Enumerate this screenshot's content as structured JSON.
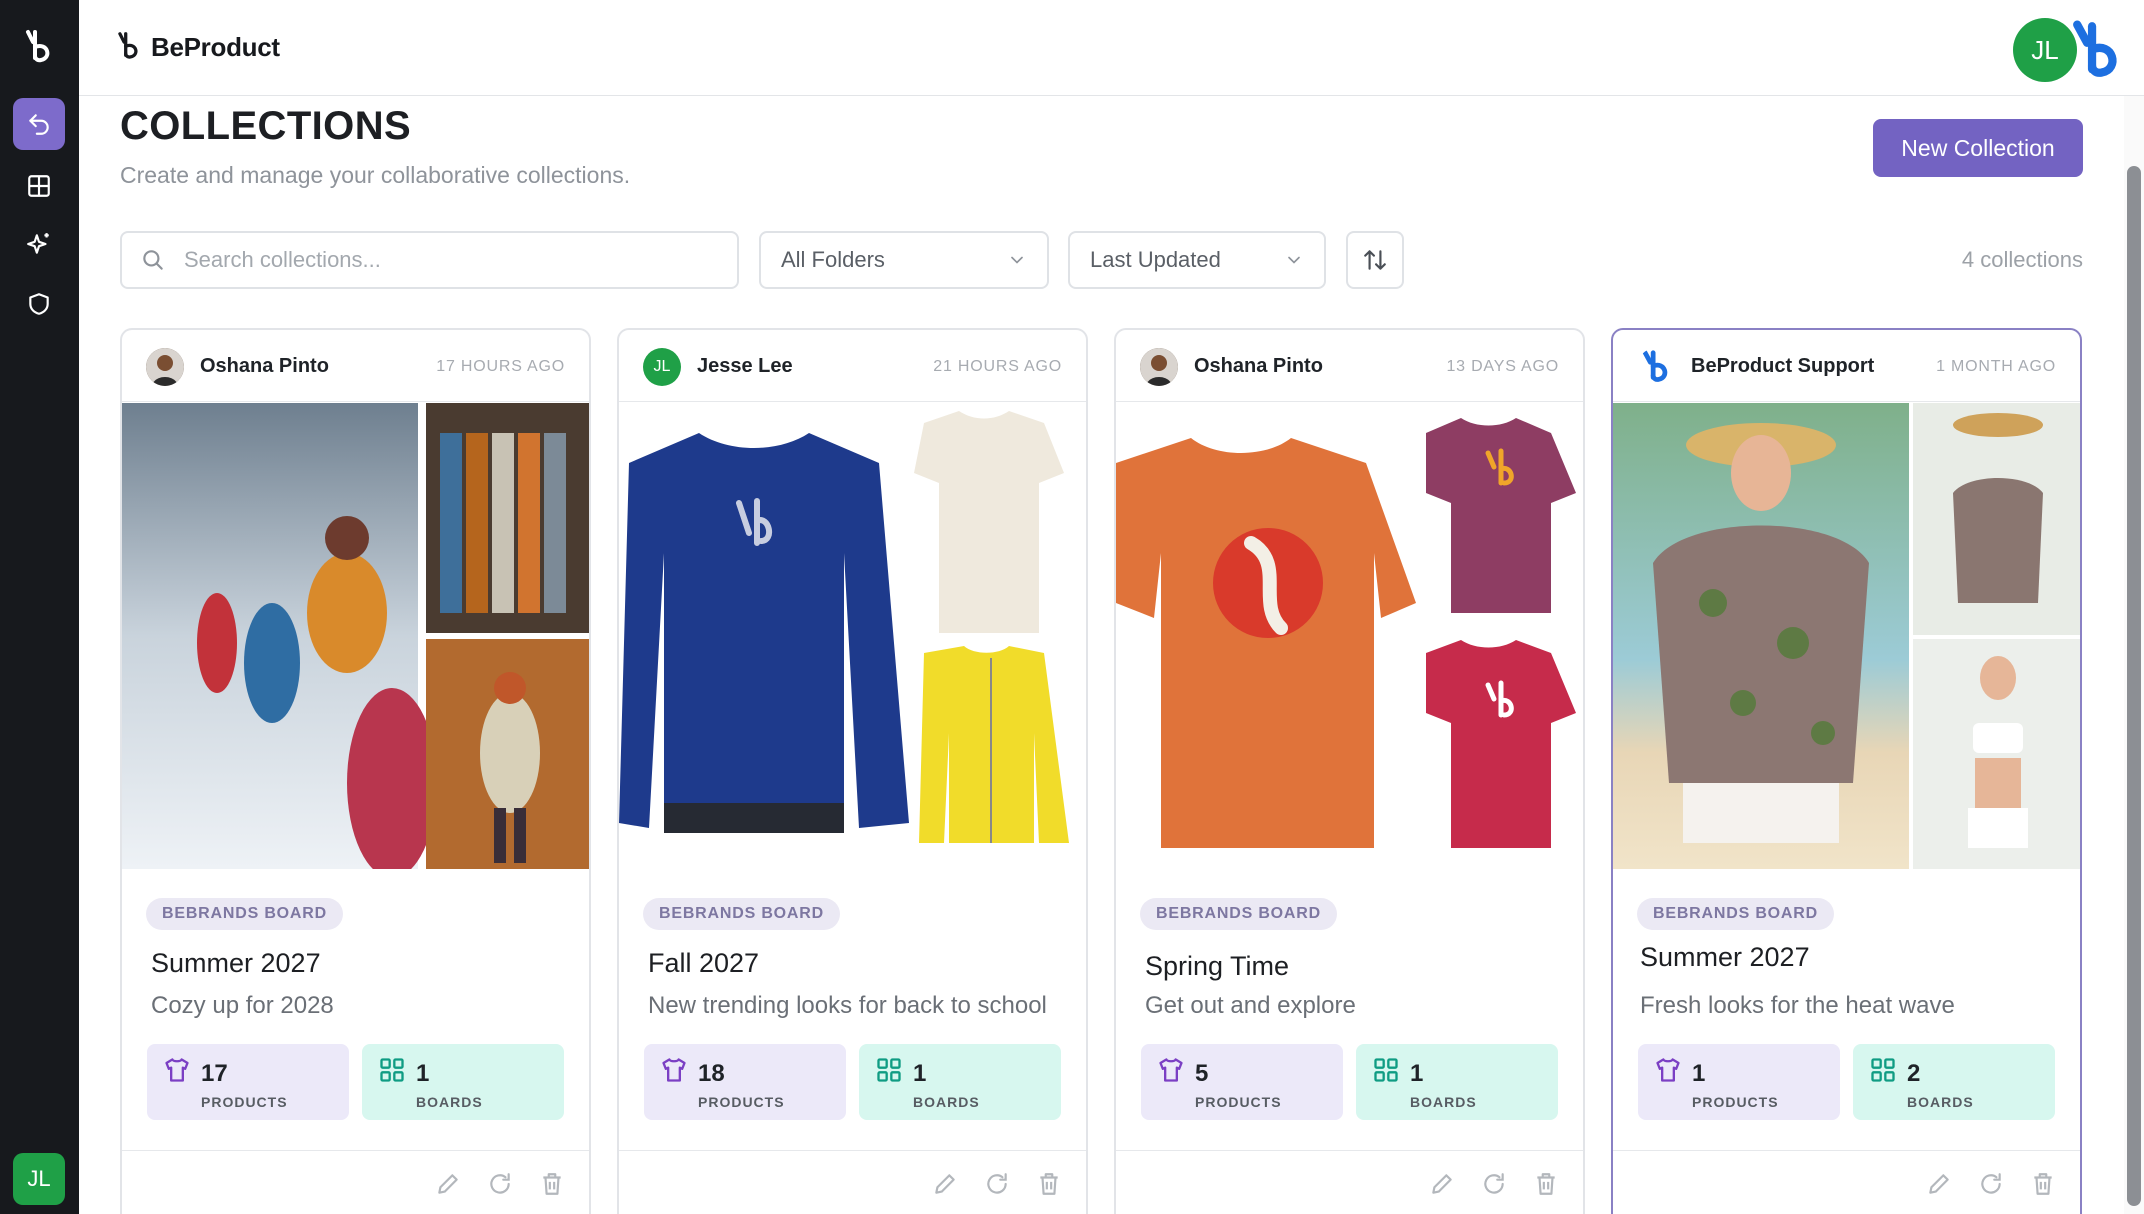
{
  "app": {
    "brand": "BeProduct",
    "user_initials": "JL"
  },
  "header": {
    "title": "COLLECTIONS",
    "subtitle": "Create and manage your collaborative collections.",
    "new_button": "New Collection"
  },
  "filters": {
    "search_placeholder": "Search collections...",
    "folder": "All Folders",
    "sort": "Last Updated",
    "count": "4 collections"
  },
  "colors": {
    "accent": "#7363c2",
    "products_bg": "#ece9f9",
    "boards_bg": "#d7f7ef",
    "avatar_green": "#1fa047"
  },
  "cards": [
    {
      "owner": "Oshana Pinto",
      "time": "17 HOURS AGO",
      "badge": "BEBRANDS BOARD",
      "title": "Summer 2027",
      "description": "Cozy up for 2028",
      "products": "17",
      "products_label": "PRODUCTS",
      "boards": "1",
      "boards_label": "BOARDS"
    },
    {
      "owner": "Jesse Lee",
      "owner_initials": "JL",
      "time": "21 HOURS AGO",
      "badge": "BEBRANDS BOARD",
      "title": "Fall 2027",
      "description": "New trending looks for back to school",
      "products": "18",
      "products_label": "PRODUCTS",
      "boards": "1",
      "boards_label": "BOARDS"
    },
    {
      "owner": "Oshana Pinto",
      "time": "13 DAYS AGO",
      "badge": "BEBRANDS BOARD",
      "title": "Spring Time",
      "description": "Get out and explore",
      "products": "5",
      "products_label": "PRODUCTS",
      "boards": "1",
      "boards_label": "BOARDS"
    },
    {
      "owner": "BeProduct Support",
      "time": "1 MONTH AGO",
      "badge": "BEBRANDS BOARD",
      "title": "Summer 2027",
      "description": "Fresh looks for the heat wave",
      "products": "1",
      "products_label": "PRODUCTS",
      "boards": "2",
      "boards_label": "BOARDS"
    }
  ]
}
